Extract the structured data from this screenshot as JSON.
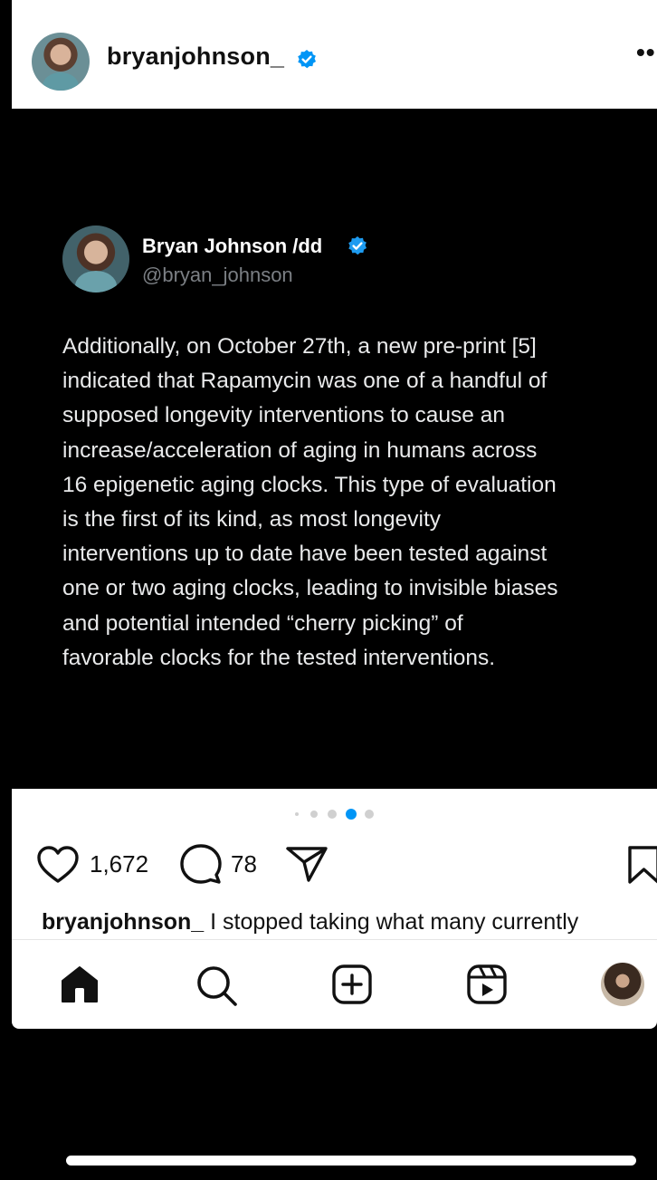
{
  "post": {
    "username": "bryanjohnson_",
    "verified": true,
    "more_label": "••"
  },
  "tweet": {
    "name": "Bryan Johnson /dd",
    "handle": "@bryan_johnson",
    "lines": [
      "Additionally, on October 27th, a new pre-print [5]",
      "indicated that Rapamycin was one of a handful of",
      "supposed longevity interventions to cause an",
      "increase/acceleration of aging in humans across",
      "16 epigenetic aging clocks. This type of evaluation",
      "is the first of its kind, as most longevity",
      "interventions up to date have been tested against",
      "one or two aging clocks, leading to invisible biases",
      "and potential intended “cherry picking” of",
      "favorable clocks for the tested interventions."
    ]
  },
  "carousel": {
    "total_visible_dots": 5,
    "active_index": 3
  },
  "actions": {
    "likes": "1,672",
    "comments": "78"
  },
  "caption": {
    "username": "bryanjohnson_",
    "text": " I stopped taking what many currently"
  },
  "nav": {
    "items": [
      "home-icon",
      "search-icon",
      "create-icon",
      "reels-icon",
      "profile-avatar"
    ]
  },
  "colors": {
    "accent": "#0095f6",
    "verified": "#1d9bf0"
  }
}
